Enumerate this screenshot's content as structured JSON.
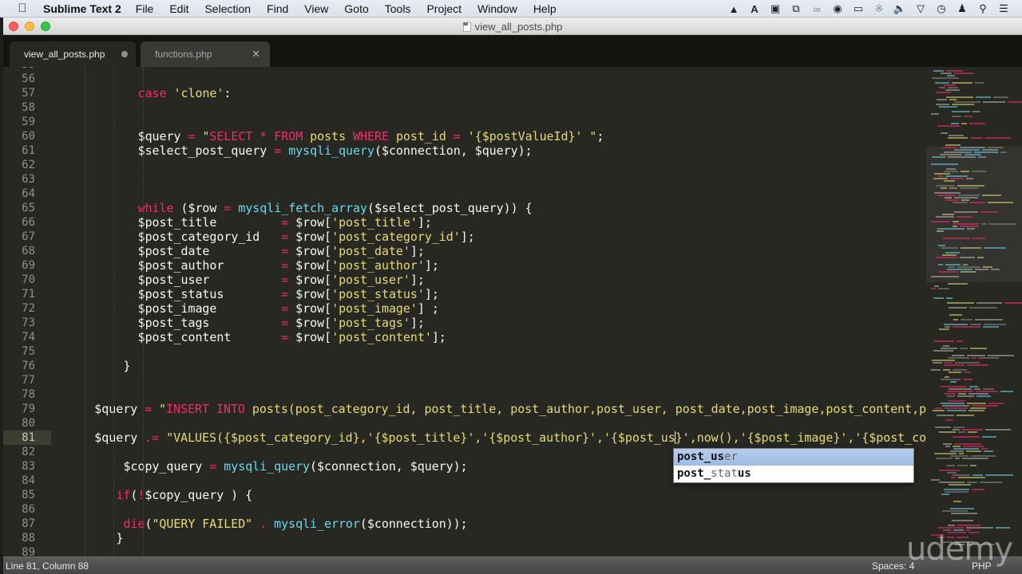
{
  "menubar": {
    "app_name": "Sublime Text 2",
    "items": [
      "File",
      "Edit",
      "Selection",
      "Find",
      "View",
      "Goto",
      "Tools",
      "Project",
      "Window",
      "Help"
    ],
    "status_icons": [
      "google-drive-icon",
      "adobe-icon",
      "more-icon",
      "screen-capture-icon",
      "switch-icon",
      "creative-cloud-icon",
      "record-icon",
      "airplay-icon",
      "bluetooth-icon",
      "volume-icon",
      "wifi-icon",
      "clock-icon",
      "user-icon",
      "spotlight-icon",
      "notification-center-icon"
    ]
  },
  "window": {
    "title": "view_all_posts.php"
  },
  "tabs": [
    {
      "label": "view_all_posts.php",
      "active": true,
      "modified": true
    },
    {
      "label": "functions.php",
      "active": false,
      "modified": false
    }
  ],
  "editor": {
    "first_partial_line": "55",
    "last_partial_line": "89",
    "current_line": 81,
    "lines": [
      {
        "n": "56",
        "tokens": []
      },
      {
        "n": "57",
        "indent": 12,
        "tokens": [
          [
            "k",
            "case"
          ],
          [
            "p",
            " "
          ],
          [
            "s",
            "'clone'"
          ],
          [
            "p",
            ":"
          ]
        ]
      },
      {
        "n": "58",
        "tokens": []
      },
      {
        "n": "59",
        "tokens": []
      },
      {
        "n": "60",
        "indent": 12,
        "tokens": [
          [
            "v",
            "$query"
          ],
          [
            "p",
            " "
          ],
          [
            "k",
            "="
          ],
          [
            "p",
            " "
          ],
          [
            "s",
            "\""
          ],
          [
            "k",
            "SELECT * FROM"
          ],
          [
            "s",
            " posts "
          ],
          [
            "k",
            "WHERE"
          ],
          [
            "s",
            " post_id "
          ],
          [
            "k",
            "="
          ],
          [
            "s",
            " '{$postValueId}' \""
          ],
          [
            "p",
            ";"
          ]
        ]
      },
      {
        "n": "61",
        "indent": 12,
        "tokens": [
          [
            "v",
            "$select_post_query"
          ],
          [
            "p",
            " "
          ],
          [
            "k",
            "="
          ],
          [
            "p",
            " "
          ],
          [
            "f",
            "mysqli_query"
          ],
          [
            "p",
            "($connection, $query);"
          ]
        ]
      },
      {
        "n": "62",
        "tokens": []
      },
      {
        "n": "63",
        "tokens": []
      },
      {
        "n": "64",
        "tokens": []
      },
      {
        "n": "65",
        "indent": 12,
        "tokens": [
          [
            "k",
            "while"
          ],
          [
            "p",
            " ($row "
          ],
          [
            "k",
            "="
          ],
          [
            "p",
            " "
          ],
          [
            "f",
            "mysqli_fetch_array"
          ],
          [
            "p",
            "($select_post_query)) {"
          ]
        ]
      },
      {
        "n": "66",
        "indent": 12,
        "tokens": [
          [
            "v",
            "$post_title         "
          ],
          [
            "k",
            "="
          ],
          [
            "p",
            " $row["
          ],
          [
            "s",
            "'post_title'"
          ],
          [
            "p",
            "];"
          ]
        ]
      },
      {
        "n": "67",
        "indent": 12,
        "tokens": [
          [
            "v",
            "$post_category_id   "
          ],
          [
            "k",
            "="
          ],
          [
            "p",
            " $row["
          ],
          [
            "s",
            "'post_category_id'"
          ],
          [
            "p",
            "];"
          ]
        ]
      },
      {
        "n": "68",
        "indent": 12,
        "tokens": [
          [
            "v",
            "$post_date          "
          ],
          [
            "k",
            "="
          ],
          [
            "p",
            " $row["
          ],
          [
            "s",
            "'post_date'"
          ],
          [
            "p",
            "];"
          ]
        ]
      },
      {
        "n": "69",
        "indent": 12,
        "tokens": [
          [
            "v",
            "$post_author        "
          ],
          [
            "k",
            "="
          ],
          [
            "p",
            " $row["
          ],
          [
            "s",
            "'post_author'"
          ],
          [
            "p",
            "];"
          ]
        ]
      },
      {
        "n": "70",
        "indent": 12,
        "tokens": [
          [
            "v",
            "$post_user          "
          ],
          [
            "k",
            "="
          ],
          [
            "p",
            " $row["
          ],
          [
            "s",
            "'post_user'"
          ],
          [
            "p",
            "];"
          ]
        ]
      },
      {
        "n": "71",
        "indent": 12,
        "tokens": [
          [
            "v",
            "$post_status        "
          ],
          [
            "k",
            "="
          ],
          [
            "p",
            " $row["
          ],
          [
            "s",
            "'post_status'"
          ],
          [
            "p",
            "];"
          ]
        ]
      },
      {
        "n": "72",
        "indent": 12,
        "tokens": [
          [
            "v",
            "$post_image         "
          ],
          [
            "k",
            "="
          ],
          [
            "p",
            " $row["
          ],
          [
            "s",
            "'post_image'"
          ],
          [
            "p",
            "] ;"
          ]
        ]
      },
      {
        "n": "73",
        "indent": 12,
        "tokens": [
          [
            "v",
            "$post_tags          "
          ],
          [
            "k",
            "="
          ],
          [
            "p",
            " $row["
          ],
          [
            "s",
            "'post_tags'"
          ],
          [
            "p",
            "];"
          ]
        ]
      },
      {
        "n": "74",
        "indent": 12,
        "tokens": [
          [
            "v",
            "$post_content       "
          ],
          [
            "k",
            "="
          ],
          [
            "p",
            " $row["
          ],
          [
            "s",
            "'post_content'"
          ],
          [
            "p",
            "];"
          ]
        ]
      },
      {
        "n": "75",
        "tokens": []
      },
      {
        "n": "76",
        "indent": 10,
        "tokens": [
          [
            "p",
            "}"
          ]
        ]
      },
      {
        "n": "77",
        "tokens": []
      },
      {
        "n": "78",
        "tokens": []
      },
      {
        "n": "79",
        "indent": 6,
        "tokens": [
          [
            "v",
            "$query"
          ],
          [
            "p",
            " "
          ],
          [
            "k",
            "="
          ],
          [
            "p",
            " "
          ],
          [
            "s",
            "\""
          ],
          [
            "k",
            "INSERT INTO"
          ],
          [
            "s",
            " posts(post_category_id, post_title, post_author,post_user, post_date,post_image,post_content,post_tags,post_status) "
          ]
        ]
      },
      {
        "n": "80",
        "tokens": []
      },
      {
        "n": "81",
        "indent": 6,
        "tokens": [
          [
            "v",
            "$query"
          ],
          [
            "p",
            " "
          ],
          [
            "k",
            ".="
          ],
          [
            "p",
            " "
          ],
          [
            "s",
            "\"VALUES({$post_category_id},'{$post_title}','{$post_author}','{$post_us"
          ],
          [
            "caret",
            ""
          ],
          [
            "s",
            "}',now(),'{$post_image}','{$post_content}',"
          ]
        ]
      },
      {
        "n": "82",
        "tokens": []
      },
      {
        "n": "83",
        "indent": 10,
        "tokens": [
          [
            "v",
            "$copy_query"
          ],
          [
            "p",
            " "
          ],
          [
            "k",
            "="
          ],
          [
            "p",
            " "
          ],
          [
            "f",
            "mysqli_query"
          ],
          [
            "p",
            "($connection, $query);"
          ]
        ]
      },
      {
        "n": "84",
        "tokens": []
      },
      {
        "n": "85",
        "indent": 9,
        "tokens": [
          [
            "k",
            "if"
          ],
          [
            "p",
            "("
          ],
          [
            "k",
            "!"
          ],
          [
            "p",
            "$copy_query ) {"
          ]
        ]
      },
      {
        "n": "86",
        "tokens": []
      },
      {
        "n": "87",
        "indent": 10,
        "tokens": [
          [
            "k",
            "die"
          ],
          [
            "p",
            "("
          ],
          [
            "s",
            "\"QUERY FAILED\""
          ],
          [
            "p",
            " "
          ],
          [
            "k",
            "."
          ],
          [
            "p",
            " "
          ],
          [
            "f",
            "mysqli_error"
          ],
          [
            "p",
            "($connection));"
          ]
        ]
      },
      {
        "n": "88",
        "indent": 9,
        "tokens": [
          [
            "p",
            "}"
          ]
        ]
      }
    ]
  },
  "autocomplete": {
    "items": [
      {
        "typed": "post_us",
        "rest": "er",
        "selected": true
      },
      {
        "typed": "post_",
        "mid": "stat",
        "match2": "us",
        "selected": false
      }
    ]
  },
  "statusbar": {
    "position": "Line 81, Column 88",
    "spaces": "Spaces: 4",
    "syntax": "PHP"
  },
  "watermark": "udemy"
}
